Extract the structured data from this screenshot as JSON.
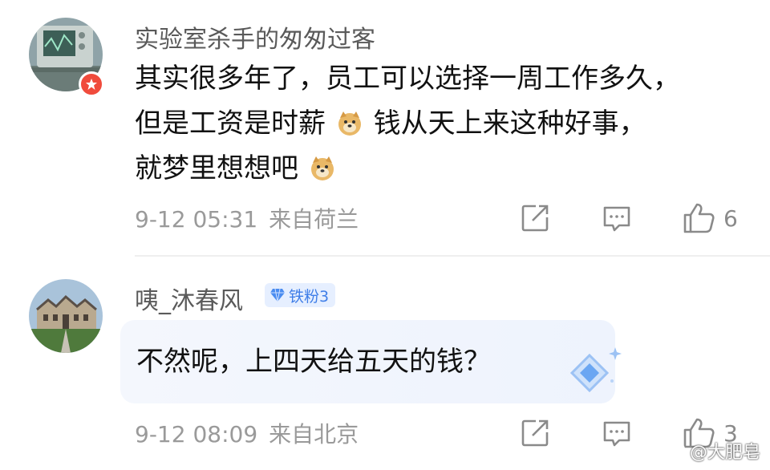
{
  "comments": [
    {
      "username": "实验室杀手的匆匆过客",
      "text_lines": [
        {
          "a": "其实很多年了，员工可以选择一周工作多久，",
          "emoji": "",
          "b": ""
        },
        {
          "a": "但是工资是时薪",
          "emoji": "doge-emoji",
          "b": " 钱从天上来这种好事，"
        },
        {
          "a": "就梦里想想吧",
          "emoji": "doge-emoji",
          "b": ""
        }
      ],
      "time": "9-12 05:31",
      "source": "来自荷兰",
      "likes": "6"
    },
    {
      "username": "咦_沐春风",
      "fan_badge": "铁粉3",
      "text": "不然呢，上四天给五天的钱？",
      "time": "9-12 08:09",
      "source": "来自北京",
      "likes": "3"
    }
  ],
  "watermark": "@大肥皂",
  "colors": {
    "meta_gray": "#9a9a9a",
    "fan_blue": "#3f7ee8",
    "verified_red": "#f04b3c"
  }
}
